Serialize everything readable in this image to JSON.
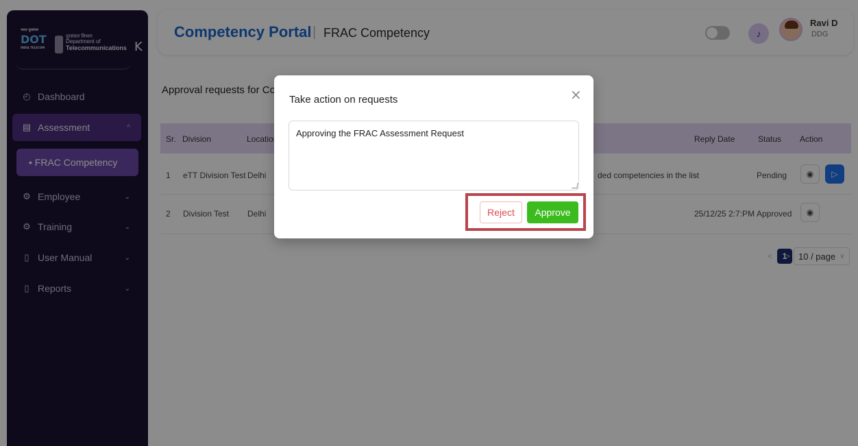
{
  "sidebar": {
    "logo": {
      "ddt_top": "भारत दूरसंचार",
      "ddt_mark": "DOT",
      "ddt_bottom": "INDIA TELECOM",
      "dept_hindi": "दूरसंचार विभाग",
      "dept_line1": "Department of",
      "dept_line2": "Telecommunications"
    },
    "collapse_label": "K",
    "items": [
      {
        "label": "Dashboard",
        "icon": "dashboard-icon"
      },
      {
        "label": "Assessment",
        "icon": "document-icon"
      },
      {
        "label": "Employee",
        "icon": "gear-icon"
      },
      {
        "label": "Training",
        "icon": "gear-icon"
      },
      {
        "label": "User Manual",
        "icon": "book-icon"
      },
      {
        "label": "Reports",
        "icon": "book-icon"
      }
    ],
    "sub_item": "• FRAC Competency"
  },
  "header": {
    "title": "Competency Portal",
    "separator": "|",
    "subtitle": "FRAC Competency",
    "user_name": "Ravi D",
    "user_role": "DDG"
  },
  "page": {
    "heading": "Approval requests for Co"
  },
  "table": {
    "columns": [
      "Sr.",
      "Division",
      "Location",
      "Reply Date",
      "Status",
      "Action"
    ],
    "rows": [
      {
        "sr": "1",
        "division": "eTT Division Test",
        "location": "Delhi",
        "remark": "ded competencies in the list",
        "reply_date": "-",
        "status": "Pending"
      },
      {
        "sr": "2",
        "division": "Division Test",
        "location": "Delhi",
        "remark": "",
        "reply_date": "25/12/25 2:7:PM",
        "status": "Approved"
      }
    ]
  },
  "pagination": {
    "prev": "<",
    "current": "1",
    "next": ">",
    "page_size": "10 / page"
  },
  "modal": {
    "title": "Take action on requests",
    "close": "×",
    "text": "Approving the FRAC Assessment Request",
    "reject_label": "Reject",
    "approve_label": "Approve"
  }
}
